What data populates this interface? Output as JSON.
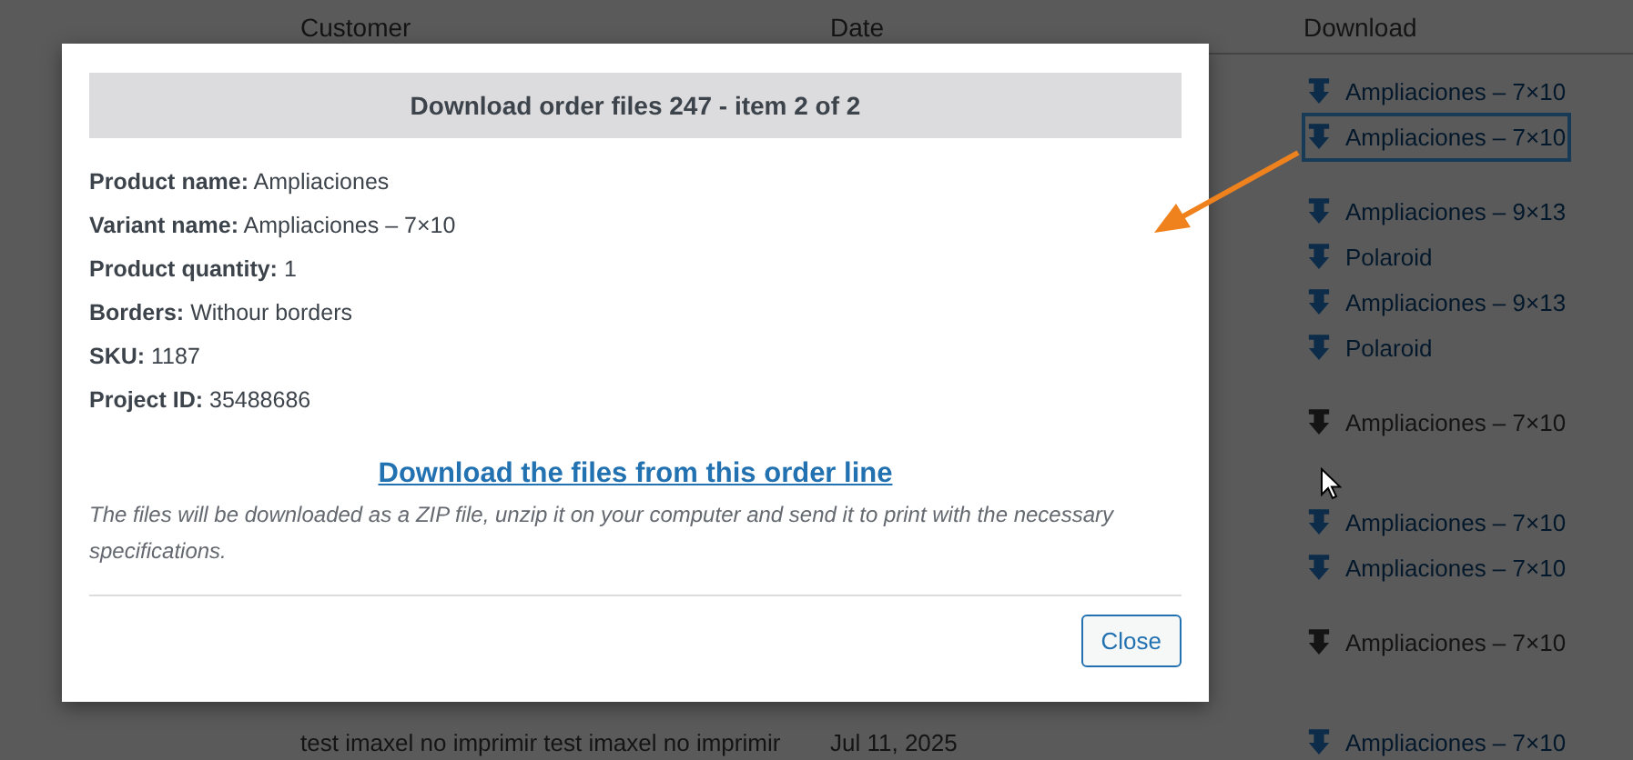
{
  "table": {
    "columns": [
      "Customer",
      "Date",
      "Download"
    ],
    "rows": [
      {
        "downloads": [
          {
            "label": "Ampliaciones – 7×10",
            "kind": "link",
            "focused": false
          },
          {
            "label": "Ampliaciones – 7×10",
            "kind": "link",
            "focused": true
          }
        ]
      },
      {
        "downloads": [
          {
            "label": "Ampliaciones – 9×13",
            "kind": "link",
            "focused": false
          },
          {
            "label": "Polaroid",
            "kind": "link",
            "focused": false
          },
          {
            "label": "Ampliaciones – 9×13",
            "kind": "link",
            "focused": false
          },
          {
            "label": "Polaroid",
            "kind": "link",
            "focused": false
          }
        ]
      },
      {
        "downloads": [
          {
            "label": "Ampliaciones – 7×10",
            "kind": "plain",
            "focused": false
          }
        ]
      },
      {
        "downloads": [
          {
            "label": "Ampliaciones – 7×10",
            "kind": "link",
            "focused": false
          },
          {
            "label": "Ampliaciones – 7×10",
            "kind": "link",
            "focused": false
          }
        ]
      },
      {
        "downloads": [
          {
            "label": "Ampliaciones – 7×10",
            "kind": "plain",
            "focused": false
          }
        ]
      },
      {
        "customer": "test imaxel no imprimir test imaxel no imprimir",
        "date": "Jul 11, 2025",
        "downloads": [
          {
            "label": "Ampliaciones – 7×10",
            "kind": "link",
            "focused": false
          }
        ]
      }
    ]
  },
  "modal": {
    "title": "Download order files 247 - item 2 of 2",
    "details": [
      {
        "label": "Product name:",
        "value": "Ampliaciones"
      },
      {
        "label": "Variant name:",
        "value": "Ampliaciones – 7×10"
      },
      {
        "label": "Product quantity:",
        "value": "1"
      },
      {
        "label": "Borders:",
        "value": "Withour borders"
      },
      {
        "label": "SKU:",
        "value": "1187"
      },
      {
        "label": "Project ID:",
        "value": "35488686"
      }
    ],
    "download_link": "Download the files from this order line",
    "note": "The files will be downloaded as a ZIP file, unzip it on your computer and send it to print with the necessary specifications.",
    "close_button": "Close"
  }
}
